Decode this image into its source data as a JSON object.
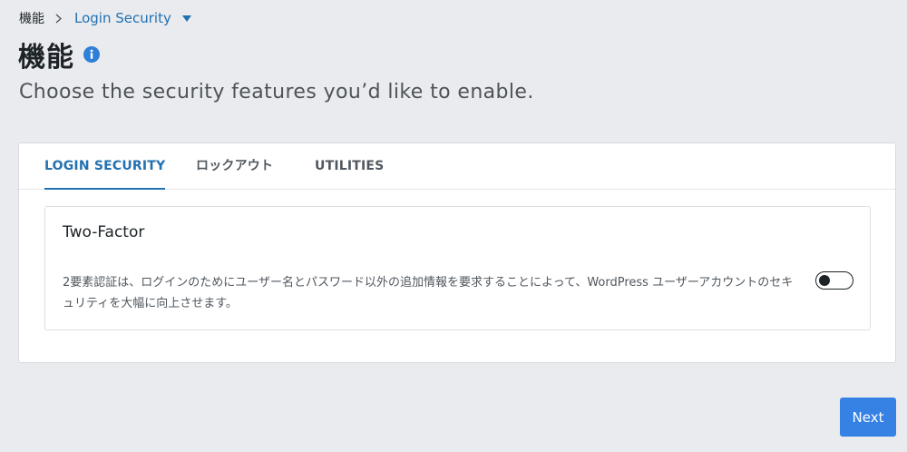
{
  "breadcrumb": {
    "root": "機能",
    "separator_icon": "chevron-right-icon",
    "current": "Login Security",
    "dropdown_icon": "caret-down-icon"
  },
  "header": {
    "title": "機能",
    "info_icon": "info-icon",
    "subtitle": "Choose the security features you’d like to enable."
  },
  "tabs": [
    {
      "label": "LOGIN SECURITY",
      "active": true
    },
    {
      "label": "ロックアウト",
      "active": false
    },
    {
      "label": "UTILITIES",
      "active": false
    }
  ],
  "feature": {
    "title": "Two-Factor",
    "description": "2要素認証は、ログインのためにユーザー名とパスワード以外の追加情報を要求することによって、WordPress ユーザーアカウントのセキュリティを大幅に向上させます。",
    "enabled": false
  },
  "footer": {
    "next_label": "Next"
  },
  "colors": {
    "accent": "#2271b1",
    "button": "#3582e4",
    "background": "#e9ebef"
  }
}
